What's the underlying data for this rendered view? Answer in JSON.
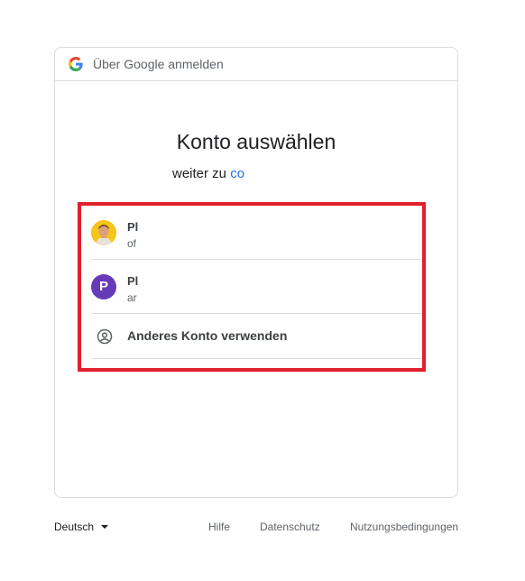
{
  "header": {
    "text": "Über Google anmelden",
    "logo": "google-g-logo"
  },
  "main": {
    "title": "Konto auswählen",
    "subtitle_prefix": "weiter zu ",
    "subtitle_link": "co"
  },
  "accounts": [
    {
      "name": "Pl",
      "email": "of",
      "avatar": "photo",
      "avatar_bg": "#f5c518"
    },
    {
      "name": "Pl",
      "email": "ar",
      "avatar": "P",
      "avatar_bg": "#673ab7"
    }
  ],
  "other_account": {
    "label": "Anderes Konto verwenden",
    "icon": "account-circle-icon"
  },
  "footer": {
    "language": "Deutsch",
    "links": [
      "Hilfe",
      "Datenschutz",
      "Nutzungsbedingungen"
    ]
  },
  "colors": {
    "highlight": "#e0202e",
    "link": "#1a73e8",
    "border": "#dadce0"
  }
}
